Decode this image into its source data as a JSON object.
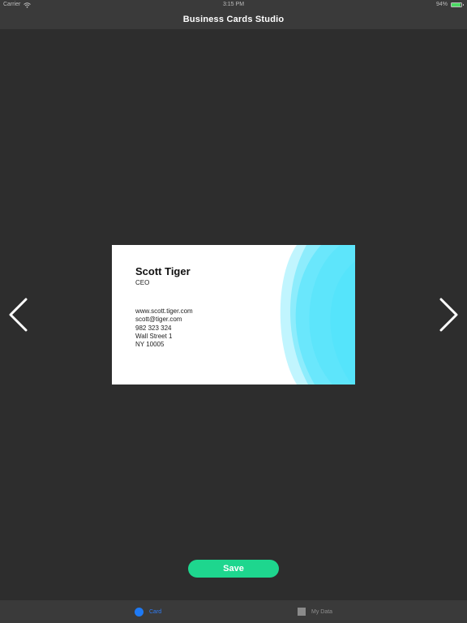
{
  "status_bar": {
    "carrier": "Carrier",
    "time": "3:15 PM",
    "battery": "94%",
    "battery_level": 0.94,
    "battery_color": "#4cd964"
  },
  "nav": {
    "title": "Business Cards Studio"
  },
  "icons": {
    "wifi": "wifi-icon",
    "battery": "battery-icon",
    "prev": "chevron-left-icon",
    "next": "chevron-right-icon",
    "card_tab": "circle-icon",
    "mydata_tab": "square-icon"
  },
  "card": {
    "name": "Scott Tiger",
    "title": "CEO",
    "website": "www.scott.tiger.com",
    "email": "scott@tiger.com",
    "phone": "982 323 324",
    "street": "Wall Street 1",
    "city": "NY 10005",
    "accent_color": "#4ee3fb"
  },
  "actions": {
    "save_label": "Save",
    "save_color": "#1ed68e"
  },
  "tabs": [
    {
      "label": "Card",
      "active": true,
      "color": "#2f7cf6"
    },
    {
      "label": "My Data",
      "active": false,
      "color": "#8e8e8e"
    }
  ]
}
